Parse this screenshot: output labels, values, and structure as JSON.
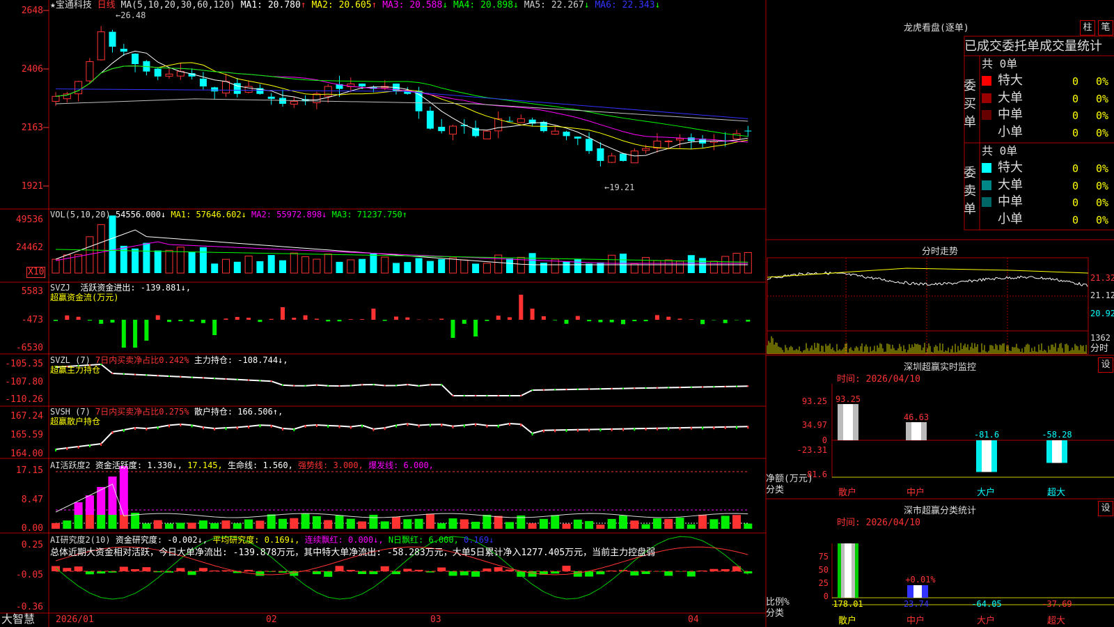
{
  "app": {
    "name": "大智慧"
  },
  "stock": {
    "name": "★宝通科技",
    "period": "日线"
  },
  "colors": {
    "up": "#ff3232",
    "down": "#00ffff",
    "bg": "#000000",
    "grid": "#a00000",
    "ma1": "#ffffff",
    "ma2": "#ffff00",
    "ma3": "#ff00ff",
    "ma4": "#00ff00",
    "ma5": "#c0c0c0",
    "ma6": "#3232ff"
  },
  "price_panel": {
    "title": "MA(5,10,20,30,60,120)",
    "ma_labels": [
      "MA1: 20.780",
      "MA2: 20.605",
      "MA3: 20.588",
      "MA4: 20.898",
      "MA5: 22.267",
      "MA6: 22.343"
    ],
    "ma_arrows": [
      "↑",
      "↑",
      "↓",
      "↓",
      "↓",
      "↓"
    ],
    "y_ticks": [
      "2648",
      "2406",
      "2163",
      "1921"
    ],
    "high_mark": "←26.48",
    "low_mark": "←19.21"
  },
  "vol_panel": {
    "title": "VOL(5,10,20)",
    "values": [
      "54556.000↓",
      "MA1: 57646.602↓",
      "MA2: 55972.898↓",
      "MA3: 71237.750↑"
    ],
    "y_ticks": [
      "49536",
      "24462"
    ],
    "unit": "X10"
  },
  "svzj_panel": {
    "title": "SVZJ",
    "text": "活跃资金进出: -139.881↓,",
    "sub": "超赢资金流(万元)",
    "y_ticks": [
      "5583",
      "-473",
      "-6530"
    ]
  },
  "svzl_panel": {
    "title": "SVZL (7)",
    "ratio": "7日内买卖净占比0.242%",
    "text": "主力持仓: -108.744↓,",
    "sub": "超赢主力持仓",
    "y_ticks": [
      "-105.35",
      "-107.80",
      "-110.26"
    ]
  },
  "svsh_panel": {
    "title": "SVSH (7)",
    "ratio": "7日内买卖净占比0.275%",
    "text": "散户持仓: 166.506↑,",
    "sub": "超赢散户持仓",
    "y_ticks": [
      "167.24",
      "165.59",
      "164.00"
    ]
  },
  "ai_active": {
    "title": "AI活跃度2",
    "v1": "资金活跃度: 1.330↓,",
    "v2": "17.145,",
    "v3": "生命线: 1.560,",
    "v4": "强势线: 3.000,",
    "v5": "爆发线: 6.000,",
    "y_ticks": [
      "17.15",
      "8.47",
      "0.00"
    ]
  },
  "ai_research": {
    "title": "AI研究度2(10)",
    "v1": "资金研究度: -0.002↓,",
    "v2": "平均研究度: 0.169↓,",
    "v3": "连续飘红: 0.000↓,",
    "v4": "N日飘红: 6.000,",
    "v5": "0.169↓",
    "summary": "总体近期大资金相对活跃，今日大单净流出: -139.878万元，其中特大单净流出: -58.283万元，大单5日累计净入1277.405万元，当前主力控盘弱",
    "y_ticks": [
      "0.25",
      "-0.05",
      "-0.36"
    ]
  },
  "x_axis": [
    "2026/01",
    "02",
    "03",
    "04"
  ],
  "right": {
    "buttons": [
      "柱",
      "笔"
    ],
    "dragon_title": "龙虎看盘(逐单)",
    "tabs": "已成交委托单成交量统计",
    "buy_label": "委买单",
    "sell_label": "委卖单",
    "buy_total": "共 0单",
    "sell_total": "共 0单",
    "rows": [
      {
        "name": "特大",
        "v": "0",
        "p": "0%"
      },
      {
        "name": "大单",
        "v": "0",
        "p": "0%"
      },
      {
        "name": "中单",
        "v": "0",
        "p": "0%"
      },
      {
        "name": "小单",
        "v": "0",
        "p": "0%"
      }
    ],
    "intraday_title": "分时走势",
    "intraday_ticks": [
      "21.32",
      "21.12",
      "20.92"
    ],
    "intraday_vol": "1362",
    "intraday_vol_label": "分时",
    "sz_monitor": {
      "title": "深圳超赢实时监控",
      "btn": "设",
      "time": "时间: 2026/04/10",
      "y_ticks": [
        "93.25",
        "34.97",
        "0",
        "-23.31",
        "-81.6"
      ],
      "ylabel": "净额(万元)",
      "xlabel": "分类",
      "categories": [
        "散户",
        "中户",
        "大户",
        "超大"
      ],
      "values": [
        93.25,
        46.63,
        -81.6,
        -58.28
      ],
      "value_labels": [
        "93.25",
        "46.63",
        "-81.6",
        "-58.28"
      ]
    },
    "sz_class": {
      "title": "深市超赢分类统计",
      "btn": "设",
      "time": "时间: 2026/04/10",
      "y_ticks": [
        "75",
        "50",
        "25",
        "0"
      ],
      "ylabel": "比例%",
      "xlabel": "分类",
      "categories": [
        "散户",
        "中户",
        "大户",
        "超大"
      ],
      "values": [
        178.01,
        23.74,
        -64.05,
        -37.69
      ],
      "value_labels": [
        "178.01",
        "23.74",
        "-64.05",
        "-37.69"
      ],
      "extra_label": "+0.01%"
    }
  }
}
